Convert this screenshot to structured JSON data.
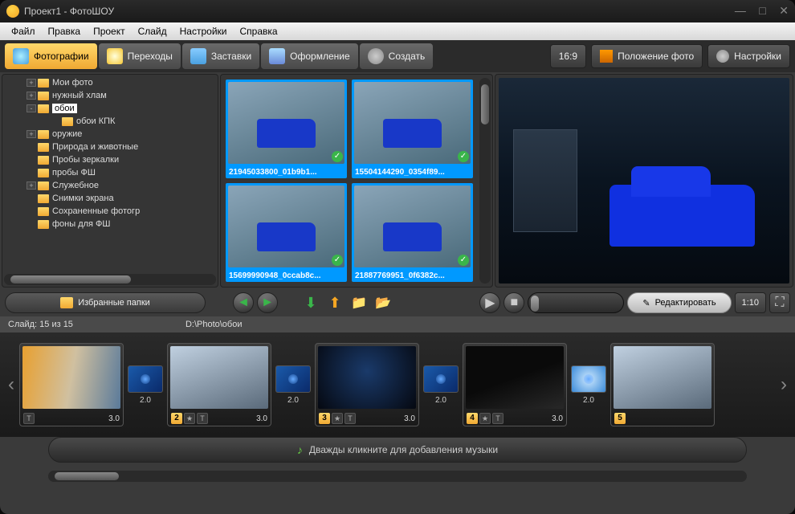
{
  "window": {
    "title": "Проект1 - ФотоШОУ"
  },
  "menu": [
    "Файл",
    "Правка",
    "Проект",
    "Слайд",
    "Настройки",
    "Справка"
  ],
  "tabs": [
    {
      "label": "Фотографии",
      "active": true,
      "icon": "#4aa0e0"
    },
    {
      "label": "Переходы",
      "active": false,
      "icon": "#f5c633"
    },
    {
      "label": "Заставки",
      "active": false,
      "icon": "#4aa0e0"
    },
    {
      "label": "Оформление",
      "active": false,
      "icon": "#6a8ad8"
    },
    {
      "label": "Создать",
      "active": false,
      "icon": "#8a8a8a"
    }
  ],
  "aspect_btn": "16:9",
  "position_btn": "Положение фото",
  "settings_btn": "Настройки",
  "folders": [
    {
      "label": "Мои фото",
      "exp": "+",
      "indent": 0
    },
    {
      "label": "нужный хлам",
      "exp": "+",
      "indent": 0
    },
    {
      "label": "обои",
      "exp": "-",
      "indent": 0,
      "sel": true
    },
    {
      "label": "обои КПК",
      "exp": "",
      "indent": 1
    },
    {
      "label": "оружие",
      "exp": "+",
      "indent": 0
    },
    {
      "label": "Природа и животные",
      "exp": "",
      "indent": 0
    },
    {
      "label": "Пробы зеркалки",
      "exp": "",
      "indent": 0
    },
    {
      "label": "пробы ФШ",
      "exp": "",
      "indent": 0
    },
    {
      "label": "Служебное",
      "exp": "+",
      "indent": 0
    },
    {
      "label": "Снимки экрана",
      "exp": "",
      "indent": 0
    },
    {
      "label": "Сохраненные фотогр",
      "exp": "",
      "indent": 0
    },
    {
      "label": "фоны для ФШ",
      "exp": "",
      "indent": 0
    }
  ],
  "fav_btn": "Избранные папки",
  "thumbs": [
    {
      "label": "21945033800_01b9b1..."
    },
    {
      "label": "15504144290_0354f89..."
    },
    {
      "label": "15699990948_0ccab8c..."
    },
    {
      "label": "21887769951_0f6382c..."
    }
  ],
  "edit_btn": "Редактировать",
  "time_display": "1:10",
  "slide_counter": "Слайд: 15 из 15",
  "path": "D:\\Photo\\обои",
  "slides": [
    {
      "n": "",
      "dur": "3.0",
      "cls": "l1",
      "icons": [
        "T"
      ]
    },
    {
      "n": "2",
      "dur": "3.0",
      "cls": "l2",
      "icons": [
        "★",
        "T"
      ]
    },
    {
      "n": "3",
      "dur": "3.0",
      "cls": "l3",
      "icons": [
        "★",
        "T"
      ]
    },
    {
      "n": "4",
      "dur": "3.0",
      "cls": "l4",
      "icons": [
        "★",
        "T"
      ]
    },
    {
      "n": "5",
      "dur": "",
      "cls": "l2",
      "icons": []
    }
  ],
  "trans_dur": "2.0",
  "music_hint": "Дважды кликните для добавления музыки"
}
